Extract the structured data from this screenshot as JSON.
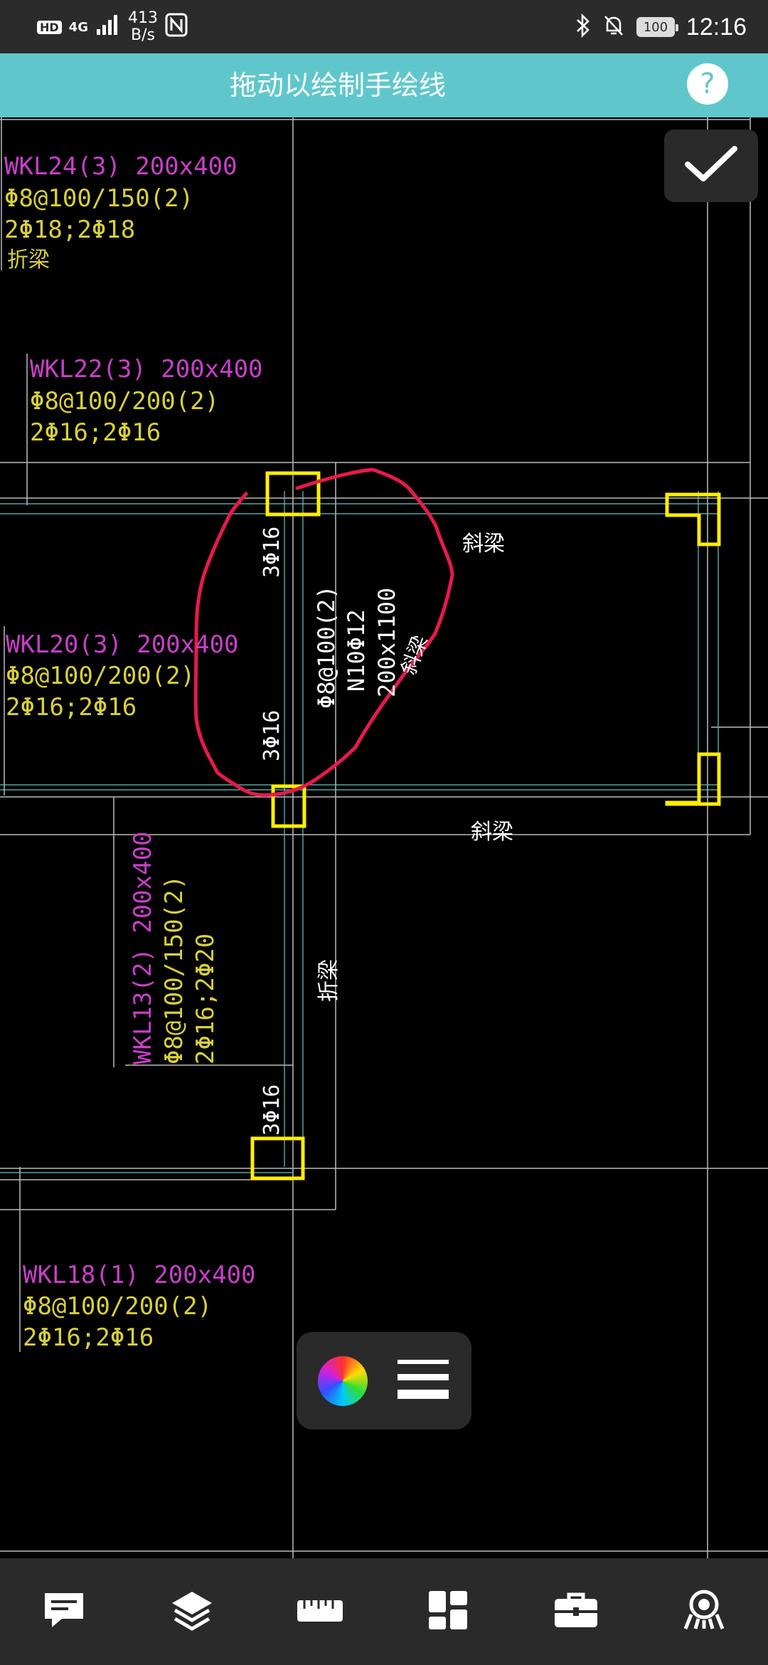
{
  "status_bar": {
    "hd": "HD",
    "net": "4G",
    "speed_value": "413",
    "speed_unit": "B/s",
    "battery": "100",
    "time": "12:16"
  },
  "title_bar": {
    "title": "拖动以绘制手绘线",
    "help": "?"
  },
  "drawing": {
    "labels": [
      {
        "id": "wkl24-1",
        "text": "WKL24(3) 200x400",
        "color": "#c93fc9"
      },
      {
        "id": "wkl24-2",
        "text": "Φ8@100/150(2)",
        "color": "#d8d03a"
      },
      {
        "id": "wkl24-3",
        "text": "2Φ18;2Φ18",
        "color": "#d8d03a"
      },
      {
        "id": "wkl24-4",
        "text": "折梁",
        "color": "#d8d03a"
      },
      {
        "id": "wkl22-1",
        "text": "WKL22(3) 200x400",
        "color": "#c93fc9"
      },
      {
        "id": "wkl22-2",
        "text": "Φ8@100/200(2)",
        "color": "#d8d03a"
      },
      {
        "id": "wkl22-3",
        "text": "2Φ16;2Φ16",
        "color": "#d8d03a"
      },
      {
        "id": "wkl20-1",
        "text": "WKL20(3) 200x400",
        "color": "#c93fc9"
      },
      {
        "id": "wkl20-2",
        "text": "Φ8@100/200(2)",
        "color": "#d8d03a"
      },
      {
        "id": "wkl20-3",
        "text": "2Φ16;2Φ16",
        "color": "#d8d03a"
      },
      {
        "id": "wkl18-1",
        "text": "WKL18(1) 200x400",
        "color": "#c93fc9"
      },
      {
        "id": "wkl18-2",
        "text": "Φ8@100/200(2)",
        "color": "#d8d03a"
      },
      {
        "id": "wkl18-3",
        "text": "2Φ16;2Φ16",
        "color": "#d8d03a"
      },
      {
        "id": "xl-1",
        "text": "斜梁",
        "color": "#ffffff"
      },
      {
        "id": "xl-2",
        "text": "斜梁",
        "color": "#ffffff"
      },
      {
        "id": "xl-3",
        "text": "斜梁",
        "color": "#ffffff"
      },
      {
        "id": "zl-1",
        "text": "折梁",
        "color": "#ffffff"
      },
      {
        "id": "col-1",
        "text": "3Φ16",
        "color": "#ffffff"
      },
      {
        "id": "col-2",
        "text": "3Φ16",
        "color": "#ffffff"
      },
      {
        "id": "col-3",
        "text": "3Φ16",
        "color": "#ffffff"
      },
      {
        "id": "vb-1",
        "text": "Φ8@100(2)",
        "color": "#ffffff"
      },
      {
        "id": "vb-2",
        "text": "N10Φ12",
        "color": "#ffffff"
      },
      {
        "id": "vb-3",
        "text": "200x1100",
        "color": "#ffffff"
      },
      {
        "id": "wkl13-1",
        "text": "WKL13(2) 200x400",
        "color": "#c93fc9"
      },
      {
        "id": "wkl13-2",
        "text": "Φ8@100/150(2)",
        "color": "#d8d03a"
      },
      {
        "id": "wkl13-3",
        "text": "2Φ16;2Φ20",
        "color": "#d8d03a"
      }
    ],
    "colors": {
      "annotation": "#e8194b",
      "column": "#ffee00",
      "grid": "#bcbcbc",
      "cyan": "#5fc7cc"
    }
  },
  "icons": {
    "confirm": "check-icon",
    "color_picker": "color-wheel-icon",
    "line_width": "line-weight-icon",
    "nav": [
      "comment-icon",
      "layers-icon",
      "ruler-icon",
      "grid-icon",
      "toolbox-icon",
      "settings-icon"
    ]
  }
}
